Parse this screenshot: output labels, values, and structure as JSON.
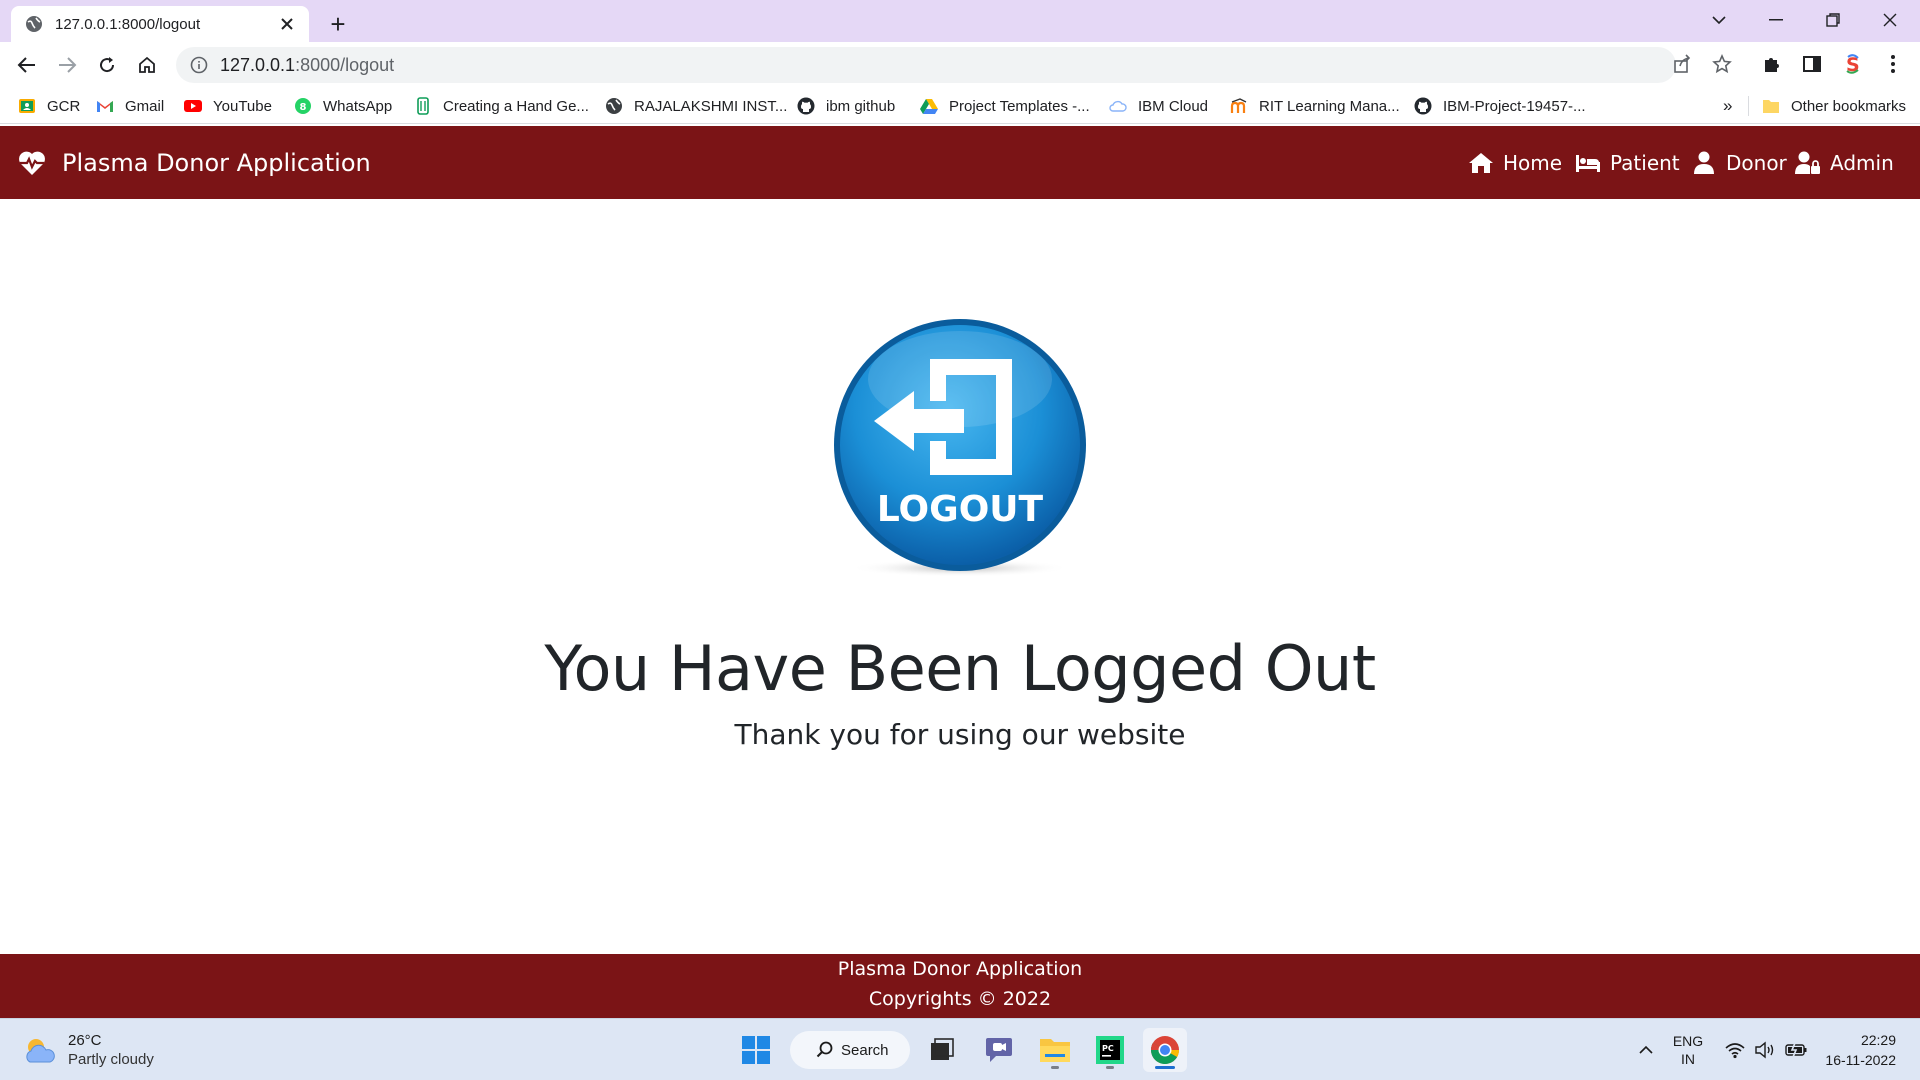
{
  "browser": {
    "tab": {
      "title": "127.0.0.1:8000/logout",
      "close_icon": "close-icon"
    },
    "new_tab_label": "+",
    "address": {
      "host": "127.0.0.1",
      "path": ":8000/logout"
    },
    "bookmarks": [
      {
        "label": "GCR",
        "icon": "google-classroom-icon"
      },
      {
        "label": "Gmail",
        "icon": "gmail-icon"
      },
      {
        "label": "YouTube",
        "icon": "youtube-icon"
      },
      {
        "label": "WhatsApp",
        "icon": "whatsapp-icon"
      },
      {
        "label": "Creating a Hand Ge...",
        "icon": "bookmark-page-icon"
      },
      {
        "label": "RAJALAKSHMI INST...",
        "icon": "globe-icon"
      },
      {
        "label": "ibm github",
        "icon": "github-icon"
      },
      {
        "label": "Project Templates -...",
        "icon": "google-drive-icon"
      },
      {
        "label": "IBM Cloud",
        "icon": "cloud-icon"
      },
      {
        "label": "RIT Learning Mana...",
        "icon": "moodle-icon"
      },
      {
        "label": "IBM-Project-19457-...",
        "icon": "github-icon"
      }
    ],
    "bookmarks_overflow": "»",
    "other_bookmarks": "Other bookmarks"
  },
  "site": {
    "brand": "Plasma Donor Application",
    "nav": [
      {
        "label": "Home",
        "icon": "home-icon"
      },
      {
        "label": "Patient",
        "icon": "bed-icon"
      },
      {
        "label": "Donor",
        "icon": "user-icon"
      },
      {
        "label": "Admin",
        "icon": "user-lock-icon"
      }
    ],
    "logout_badge": "LOGOUT",
    "headline": "You Have Been Logged Out",
    "subline": "Thank you for using our website",
    "footer": {
      "line1": "Plasma Donor Application",
      "line2": "Copyrights © 2022"
    }
  },
  "taskbar": {
    "weather": {
      "temp": "26°C",
      "condition": "Partly cloudy"
    },
    "search_label": "Search",
    "tray": {
      "lang": "ENG",
      "region": "IN"
    },
    "clock": {
      "time": "22:29",
      "date": "16-11-2022"
    }
  },
  "colors": {
    "brand": "#7b1416",
    "tabstrip": "#e5d8f6",
    "taskbar": "#dde6f4",
    "logout_blue": "#1b8fd6"
  }
}
